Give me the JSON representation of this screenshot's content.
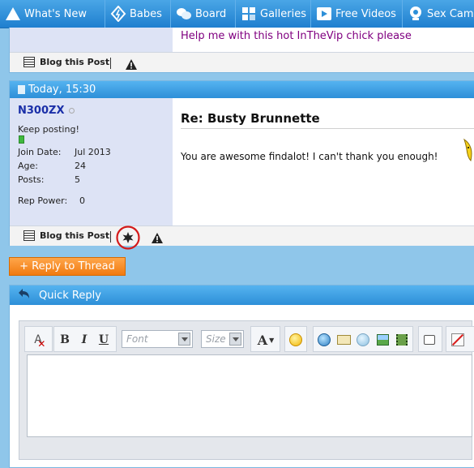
{
  "nav": {
    "items": [
      {
        "label": "What's New",
        "icon": "triangle-icon"
      },
      {
        "label": "Babes",
        "icon": "diamond-icon"
      },
      {
        "label": "Board",
        "icon": "chat-icon"
      },
      {
        "label": "Galleries",
        "icon": "galleries-icon"
      },
      {
        "label": "Free Videos",
        "icon": "play-icon"
      },
      {
        "label": "Sex Cams",
        "icon": "webcam-icon"
      }
    ]
  },
  "prev_post": {
    "message": "Help me with this hot InTheVip chick please",
    "blog_label": "Blog this Post"
  },
  "post": {
    "date": "Today, 15:30",
    "username": "N300ZX",
    "user_title": "Keep posting!",
    "join_date_label": "Join Date:",
    "join_date": "Jul 2013",
    "age_label": "Age:",
    "age": "24",
    "posts_label": "Posts:",
    "posts": "5",
    "rep_label": "Rep Power:",
    "rep": "0",
    "title": "Re: Busty Brunnette",
    "body": "You are awesome findalot! I can't thank you enough!",
    "blog_label": "Blog this Post"
  },
  "reply_button": "+ Reply to Thread",
  "quick_reply": {
    "title": "Quick Reply",
    "font_placeholder": "Font",
    "size_placeholder": "Size"
  },
  "colors": {
    "accent": "#2d8fd8",
    "link": "#1a2fa8",
    "prev_message": "#800080",
    "reply_button": "#f07a10"
  }
}
